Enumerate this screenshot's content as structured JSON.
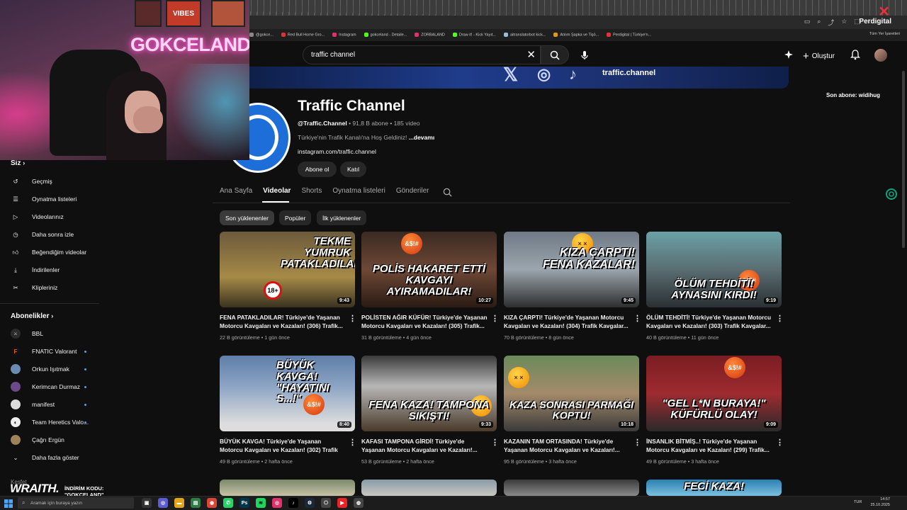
{
  "browser": {
    "profile_label": "Perdigital",
    "bookmarks": [
      "@gokce...",
      "Red Bull Home Gro...",
      "Instagram",
      "gokceland - Detaile...",
      "ZORBALAND",
      "Draw it! - Kick Yayıt...",
      "aitranslatorbot kick...",
      "Atılım Şapka ve Tişö...",
      "Perdigital | Türkiye'n..."
    ],
    "bookmarks_right": "Tüm Yer İşaretleri"
  },
  "masthead": {
    "search_value": "traffic channel",
    "create_label": "Oluştur"
  },
  "banner": {
    "handle": "traffic.channel"
  },
  "last_subscriber": "Son abone: widihug",
  "channel": {
    "name": "Traffic Channel",
    "handle": "@Traffic.Channel",
    "stats": " • 91,8 B abone • 185 video",
    "description": "Türkiye'nin Trafik Kanalı'na Hoş Geldiniz! ",
    "more": "...devamı",
    "link": "instagram.com/traffic.channel",
    "subscribe_label": "Abone ol",
    "join_label": "Katıl"
  },
  "tabs": [
    "Ana Sayfa",
    "Videolar",
    "Shorts",
    "Oynatma listeleri",
    "Gönderiler"
  ],
  "chips": [
    "Son yüklenenler",
    "Popüler",
    "İlk yüklenenler"
  ],
  "sidebar": {
    "you_heading": "Siz",
    "items": [
      "Geçmiş",
      "Oynatma listeleri",
      "Videolarınız",
      "Daha sonra izle",
      "Beğendiğim videolar",
      "İndirilenler",
      "Klipleriniz"
    ],
    "subs_heading": "Abonelikler",
    "subs": [
      "BBL",
      "FNATIC Valorant",
      "Orkun Işıtmak",
      "Kerimcan Durmaz",
      "manifest",
      "Team Heretics Valo...",
      "Çağrı Ergün"
    ],
    "more_label": "Daha fazla göster",
    "explore": "Keşfet"
  },
  "videos": [
    {
      "caption": "TEKME YUMRUK PATAKLADILAR!",
      "duration": "9:43",
      "title": "FENA PATAKLADILAR! Türkiye'de Yaşanan Motorcu Kavgaları ve Kazaları! (306) Trafik...",
      "meta": "22 B görüntüleme • 1 gün önce"
    },
    {
      "caption": "POLİS HAKARET ETTİ KAVGAYI AYIRAMADILAR!",
      "duration": "10:27",
      "title": "POLİSTEN AĞIR KÜFÜR! Türkiye'de Yaşanan Motorcu Kavgaları ve Kazaları! (305) Trafik...",
      "meta": "31 B görüntüleme • 4 gün önce"
    },
    {
      "caption": "KIZA ÇARPTI! FENA KAZALAR!",
      "duration": "9:45",
      "title": "KIZA ÇARPTI! Türkiye'de Yaşanan Motorcu Kavgaları ve Kazaları! (304) Trafik Kavgalar...",
      "meta": "70 B görüntüleme • 8 gün önce"
    },
    {
      "caption": "ÖLÜM TEHDİTİ! AYNASINI KIRDI!",
      "duration": "9:19",
      "title": "ÖLÜM TEHDİTİ! Türkiye'de Yaşanan Motorcu Kavgaları ve Kazaları! (303) Trafik Kavgalar...",
      "meta": "40 B görüntüleme • 11 gün önce"
    },
    {
      "caption": "BÜYÜK KAVGA! \"HAYATINI S...!\"",
      "duration": "8:40",
      "title": "BÜYÜK KAVGA! Türkiye'de Yaşanan Motorcu Kavgaları ve Kazaları! (302) Trafik Kavgalar...",
      "meta": "49 B görüntüleme • 2 hafta önce"
    },
    {
      "caption": "FENA KAZA! TAMPONA SIKIŞTI!",
      "duration": "9:33",
      "title": "KAFASI TAMPONA GİRDİ! Türkiye'de Yaşanan Motorcu Kavgaları ve Kazaları!...",
      "meta": "53 B görüntüleme • 2 hafta önce"
    },
    {
      "caption": "KAZA SONRASI PARMAĞI KOPTU!",
      "duration": "10:18",
      "title": "KAZANIN TAM ORTASINDA! Türkiye'de Yaşanan Motorcu Kavgaları ve Kazaları!...",
      "meta": "95 B görüntüleme • 3 hafta önce"
    },
    {
      "caption": "\"GEL L*N BURAYA!\" KÜFÜRLÜ OLAY!",
      "duration": "9:09",
      "title": "İNSANLIK BİTMİŞ..! Türkiye'de Yaşanan Motorcu Kavgaları ve Kazaları! (299) Trafik...",
      "meta": "49 B görüntüleme • 3 hafta önce"
    },
    {
      "caption": "",
      "duration": "",
      "title": "",
      "meta": ""
    },
    {
      "caption": "",
      "duration": "",
      "title": "",
      "meta": ""
    },
    {
      "caption": "",
      "duration": "",
      "title": "",
      "meta": ""
    },
    {
      "caption": "FECİ KAZA!",
      "duration": "",
      "title": "",
      "meta": ""
    }
  ],
  "webcam": {
    "neon_sign": "GOKCELAND",
    "poster": "VIBES"
  },
  "overlay": {
    "brand": "WRAITH.",
    "promo_line1": "İNDİRİM KODU:",
    "promo_line2": "\"GOKCELAND\""
  },
  "taskbar": {
    "search_placeholder": "Aramak için buraya yazın",
    "lang": "TUR",
    "time": "14:57",
    "date": "25.10.2025"
  },
  "colors": {
    "accent_blue": "#3ea6ff",
    "yt_bg": "#0f0f0f",
    "badge_red": "#c4122b"
  }
}
